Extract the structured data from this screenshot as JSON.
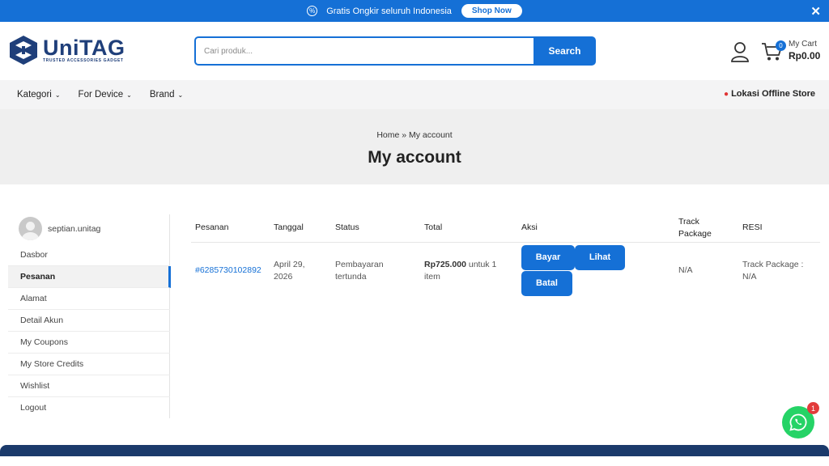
{
  "topbar": {
    "promo_text": "Gratis Ongkir seluruh Indonesia",
    "shop_now": "Shop Now",
    "close": "✕"
  },
  "header": {
    "logo_main": "UniTAG",
    "logo_sub": "TRUSTED ACCESSORIES GADGET",
    "search_placeholder": "Cari produk...",
    "search_button": "Search",
    "cart_count": "0",
    "cart_label": "My Cart",
    "cart_total": "Rp0.00"
  },
  "nav": {
    "items": [
      {
        "label": "Kategori"
      },
      {
        "label": "For Device"
      },
      {
        "label": "Brand"
      }
    ],
    "store_link": "Lokasi Offline Store"
  },
  "hero": {
    "breadcrumb": "Home » My account",
    "title": "My account"
  },
  "sidebar": {
    "username": "septian.unitag",
    "items": [
      {
        "label": "Dasbor"
      },
      {
        "label": "Pesanan"
      },
      {
        "label": "Alamat"
      },
      {
        "label": "Detail Akun"
      },
      {
        "label": "My Coupons"
      },
      {
        "label": "My Store Credits"
      },
      {
        "label": "Wishlist"
      },
      {
        "label": "Logout"
      }
    ]
  },
  "orders": {
    "headers": {
      "order": "Pesanan",
      "date": "Tanggal",
      "status": "Status",
      "total": "Total",
      "actions": "Aksi",
      "track": "Track Package",
      "resi": "RESI"
    },
    "rows": [
      {
        "order": "#6285730102892",
        "date": "April 29, 2026",
        "status": "Pembayaran tertunda",
        "total_amount": "Rp725.000",
        "total_suffix": " untuk 1 item",
        "btn_pay": "Bayar",
        "btn_view": "Lihat",
        "btn_cancel": "Batal",
        "track": "N/A",
        "resi": "Track Package : N/A"
      }
    ]
  },
  "whatsapp": {
    "badge": "1"
  },
  "colors": {
    "primary": "#1570d6",
    "logo": "#1f3f7a",
    "whatsapp": "#25d366",
    "footer": "#1b3a6b"
  }
}
